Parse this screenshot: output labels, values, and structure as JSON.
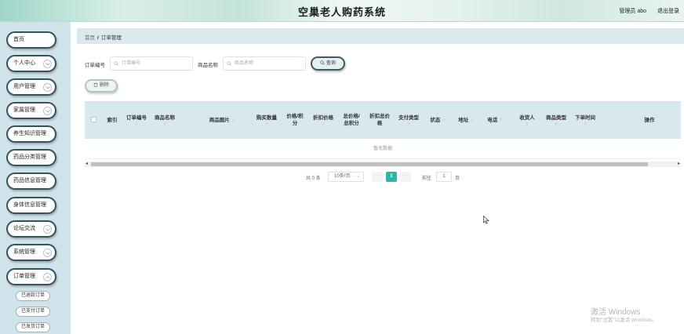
{
  "header": {
    "title": "空巢老人购药系统",
    "user": "管理员 abo",
    "logout": "退出登录"
  },
  "sidebar": {
    "items": [
      {
        "label": "首页",
        "has_chevron": false
      },
      {
        "label": "个人中心",
        "has_chevron": true
      },
      {
        "label": "用户管理",
        "has_chevron": true
      },
      {
        "label": "家属管理",
        "has_chevron": true
      },
      {
        "label": "养生知识管理",
        "has_chevron": false
      },
      {
        "label": "药品分类管理",
        "has_chevron": false
      },
      {
        "label": "药品信息管理",
        "has_chevron": false
      },
      {
        "label": "身体信息管理",
        "has_chevron": false
      },
      {
        "label": "论坛交流",
        "has_chevron": true
      },
      {
        "label": "系统管理",
        "has_chevron": true
      },
      {
        "label": "订单管理",
        "has_chevron": true
      }
    ],
    "sub_items": [
      {
        "label": "已退款订单"
      },
      {
        "label": "已支付订单"
      },
      {
        "label": "已发货订单"
      }
    ]
  },
  "breadcrumb": {
    "home": "首页",
    "separator": "/",
    "current": "订单管理"
  },
  "search": {
    "order_no_label": "订单编号",
    "order_no_placeholder": "订单编号",
    "product_label": "商品名称",
    "product_placeholder": "商品名称",
    "query_button": "查询"
  },
  "actions": {
    "delete_button": "删除"
  },
  "table": {
    "columns": [
      {
        "line1": "索引",
        "line2": ""
      },
      {
        "line1": "订单编号",
        "line2": ""
      },
      {
        "line1": "商品名称",
        "line2": ""
      },
      {
        "line1": "商品图片",
        "line2": ""
      },
      {
        "line1": "购买数量",
        "line2": ""
      },
      {
        "line1": "价格/积",
        "line2": "分"
      },
      {
        "line1": "折扣价格",
        "line2": ""
      },
      {
        "line1": "总价格/",
        "line2": "总积分"
      },
      {
        "line1": "折扣总价",
        "line2": "格"
      },
      {
        "line1": "支付类型",
        "line2": ""
      },
      {
        "line1": "状态",
        "line2": ""
      },
      {
        "line1": "地址",
        "line2": ""
      },
      {
        "line1": "电话",
        "line2": ""
      },
      {
        "line1": "收货人",
        "line2": ""
      },
      {
        "line1": "商品类型",
        "line2": ""
      },
      {
        "line1": "下单时间",
        "line2": ""
      },
      {
        "line1": "操作",
        "line2": ""
      }
    ],
    "empty_text": "暂无数据"
  },
  "pagination": {
    "total": "共 0 条",
    "page_size": "10条/页",
    "current_page": "1",
    "goto_label": "前往",
    "goto_value": "1",
    "page_unit": "页"
  },
  "watermark": {
    "title": "激活 Windows",
    "subtitle": "转到\"设置\"以激活 Windows。"
  },
  "colors": {
    "accent": "#2db6a8",
    "sidebar_bg": "#cfe3ea",
    "header_bg": "#d9efe8",
    "table_head_bg": "#d7e8ee"
  }
}
